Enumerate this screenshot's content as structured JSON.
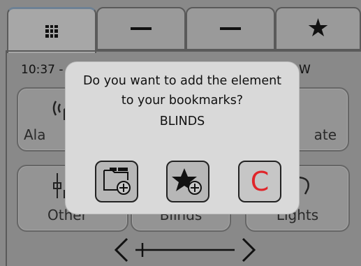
{
  "tabs": [
    {
      "name": "grid-icon"
    },
    {
      "name": "minus-icon"
    },
    {
      "name": "minus-icon"
    },
    {
      "name": "star-icon",
      "glyph": "★"
    }
  ],
  "status": {
    "time": "10:37 -",
    "right": "W"
  },
  "tiles": {
    "alarm": "Ala",
    "climate": "ate",
    "other": "Other",
    "blinds": "Blinds",
    "lights": "Lights"
  },
  "dialog": {
    "line1": "Do you want to add the element",
    "line2": "to your bookmarks?",
    "line3": "BLINDS",
    "cancel_label": "C"
  },
  "colors": {
    "cancel_text": "#e0252a",
    "dialog_bg": "#d9d9d9"
  }
}
